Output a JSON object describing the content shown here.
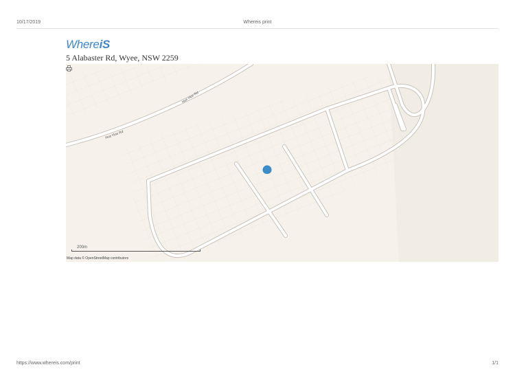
{
  "header": {
    "date": "10/17/2019",
    "title": "Whereis print"
  },
  "logo": {
    "prefix": "Where",
    "suffix": "iS"
  },
  "address": "5 Alabaster Rd, Wyee, NSW 2259",
  "map": {
    "road_labels": [
      "Hue Hue Rd",
      "Hue Hue Rd"
    ],
    "scale_label": "200m",
    "attribution": "Map data © OpenStreetMap contributors",
    "colors": {
      "land": "#f6f2eb",
      "road": "#ffffff",
      "road_edge": "#c9c4bb",
      "pin": "#3a8dc8"
    }
  },
  "footer": {
    "url": "https://www.whereis.com/print",
    "page": "1/1"
  }
}
